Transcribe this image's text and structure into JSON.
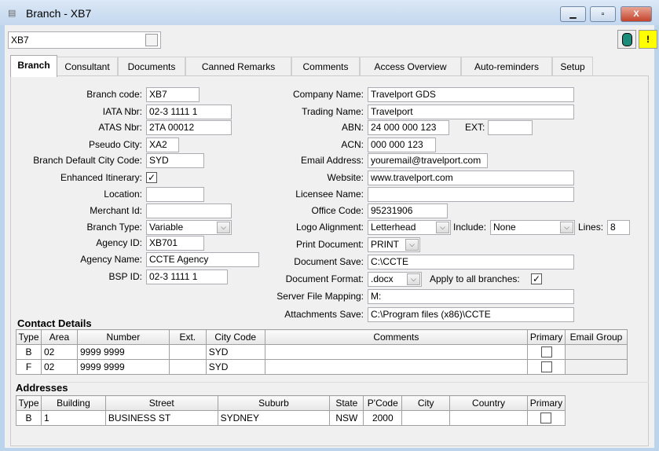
{
  "window": {
    "title": "Branch - XB7",
    "minimize": "▁",
    "maximize": "▫",
    "close": "X"
  },
  "top": {
    "record_value": "XB7",
    "db_icon": "database-icon",
    "warn_icon": "!"
  },
  "tabs": [
    "Branch",
    "Consultant",
    "Documents",
    "Canned Remarks",
    "Comments",
    "Access Overview",
    "Auto-reminders",
    "Setup"
  ],
  "left": {
    "branch_code": {
      "label": "Branch code:",
      "value": "XB7"
    },
    "iata": {
      "label": "IATA Nbr:",
      "value": "02-3 1111 1"
    },
    "atas": {
      "label": "ATAS Nbr:",
      "value": "2TA 00012"
    },
    "pseudo": {
      "label": "Pseudo City:",
      "value": "XA2"
    },
    "default_city": {
      "label": "Branch Default City Code:",
      "value": "SYD"
    },
    "enhanced": {
      "label": "Enhanced Itinerary:",
      "checked": "✓"
    },
    "location": {
      "label": "Location:",
      "value": ""
    },
    "merchant": {
      "label": "Merchant Id:",
      "value": ""
    },
    "branch_type": {
      "label": "Branch Type:",
      "value": "Variable"
    },
    "agency_id": {
      "label": "Agency ID:",
      "value": "XB701"
    },
    "agency_name": {
      "label": "Agency Name:",
      "value": "CCTE Agency"
    },
    "bsp_id": {
      "label": "BSP ID:",
      "value": "02-3 1111 1"
    }
  },
  "right": {
    "company": {
      "label": "Company Name:",
      "value": "Travelport GDS"
    },
    "trading": {
      "label": "Trading Name:",
      "value": "Travelport"
    },
    "abn": {
      "label": "ABN:",
      "value": "24 000 000 123"
    },
    "ext": {
      "label": "EXT:",
      "value": ""
    },
    "acn": {
      "label": "ACN:",
      "value": "000 000 123"
    },
    "email": {
      "label": "Email Address:",
      "value": "youremail@travelport.com"
    },
    "website": {
      "label": "Website:",
      "value": "www.travelport.com"
    },
    "licensee": {
      "label": "Licensee Name:",
      "value": ""
    },
    "office": {
      "label": "Office Code:",
      "value": "95231906"
    },
    "logo": {
      "label": "Logo Alignment:",
      "value": "Letterhead"
    },
    "include": {
      "label": "Include:",
      "value": "None"
    },
    "lines": {
      "label": "Lines:",
      "value": "8"
    },
    "print_doc": {
      "label": "Print Document:",
      "value": "PRINT"
    },
    "doc_save": {
      "label": "Document Save:",
      "value": "C:\\CCTE"
    },
    "doc_format": {
      "label": "Document Format:",
      "value": ".docx"
    },
    "apply_all": {
      "label": "Apply to all branches:",
      "checked": "✓"
    },
    "server_map": {
      "label": "Server File Mapping:",
      "value": "M:"
    },
    "attach": {
      "label": "Attachments Save:",
      "value": "C:\\Program files (x86)\\CCTE"
    }
  },
  "contacts": {
    "title": "Contact Details",
    "columns": [
      "Type",
      "Area",
      "Number",
      "Ext.",
      "City Code",
      "Comments",
      "Primary",
      "Email Group"
    ],
    "rows": [
      [
        "B",
        "02",
        "9999 9999",
        "",
        "SYD",
        ""
      ],
      [
        "F",
        "02",
        "9999 9999",
        "",
        "SYD",
        ""
      ]
    ]
  },
  "addresses": {
    "title": "Addresses",
    "columns": [
      "Type",
      "Building",
      "Street",
      "Suburb",
      "State",
      "P'Code",
      "City",
      "Country",
      "Primary"
    ],
    "rows": [
      [
        "B",
        "1",
        "BUSINESS ST",
        "SYDNEY",
        "NSW",
        "2000",
        "",
        ""
      ]
    ]
  }
}
